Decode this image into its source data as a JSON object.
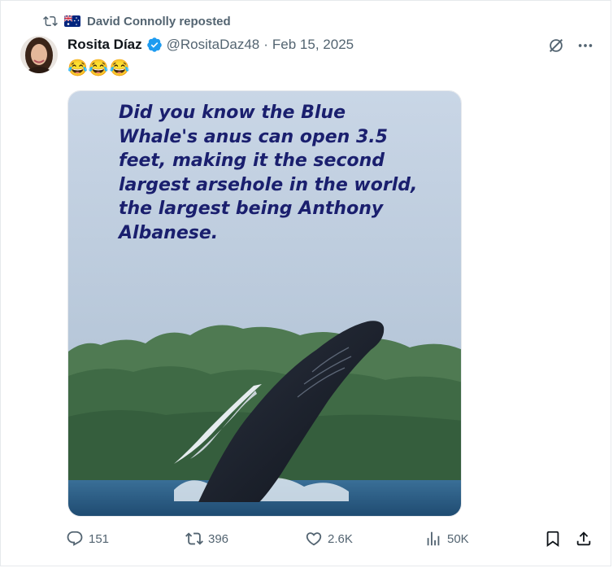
{
  "repost": {
    "label": "David Connolly reposted",
    "icon": "repost-icon",
    "flag": "australia-flag-icon"
  },
  "tweet": {
    "author_name": "Rosita Díaz",
    "handle": "@RositaDaz48",
    "separator": "·",
    "date": "Feb 15, 2025",
    "verified_icon": "verified-badge-icon",
    "text": "😂😂😂"
  },
  "media": {
    "text": "Did you know the Blue Whale's anus can open 3.5 feet, making it the second largest arsehole in the world, the largest being Anthony Albanese."
  },
  "actions": {
    "replies": "151",
    "reposts": "396",
    "likes": "2.6K",
    "views": "50K"
  },
  "colors": {
    "secondary_text": "#536471",
    "verified": "#1d9bf0",
    "meme_text": "#1a1f6e"
  }
}
